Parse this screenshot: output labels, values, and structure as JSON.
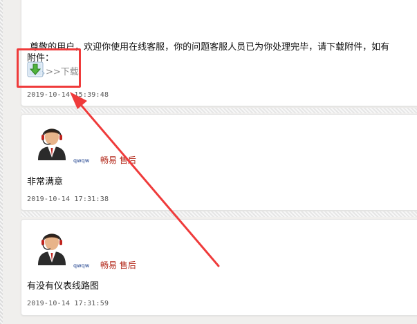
{
  "reply": {
    "text": ".尊敬的用户，欢迎你使用在线客服，你的问题客服人员已为你处理完毕，请下载附件，如有",
    "attachment_label": "附件：",
    "download_label": ">>下载",
    "timestamp": "2019-10-14 15:39:48"
  },
  "comments": [
    {
      "username": "qwqw",
      "role": "畅易 售后",
      "text": "非常满意",
      "timestamp": "2019-10-14 17:31:38"
    },
    {
      "username": "qwqw",
      "role": "畅易 售后",
      "text": "有没有仪表线路图",
      "timestamp": "2019-10-14 17:31:59"
    }
  ],
  "colors": {
    "annotation": "#ef3b3b",
    "role": "#b3281a",
    "username": "#1b3e8c"
  }
}
